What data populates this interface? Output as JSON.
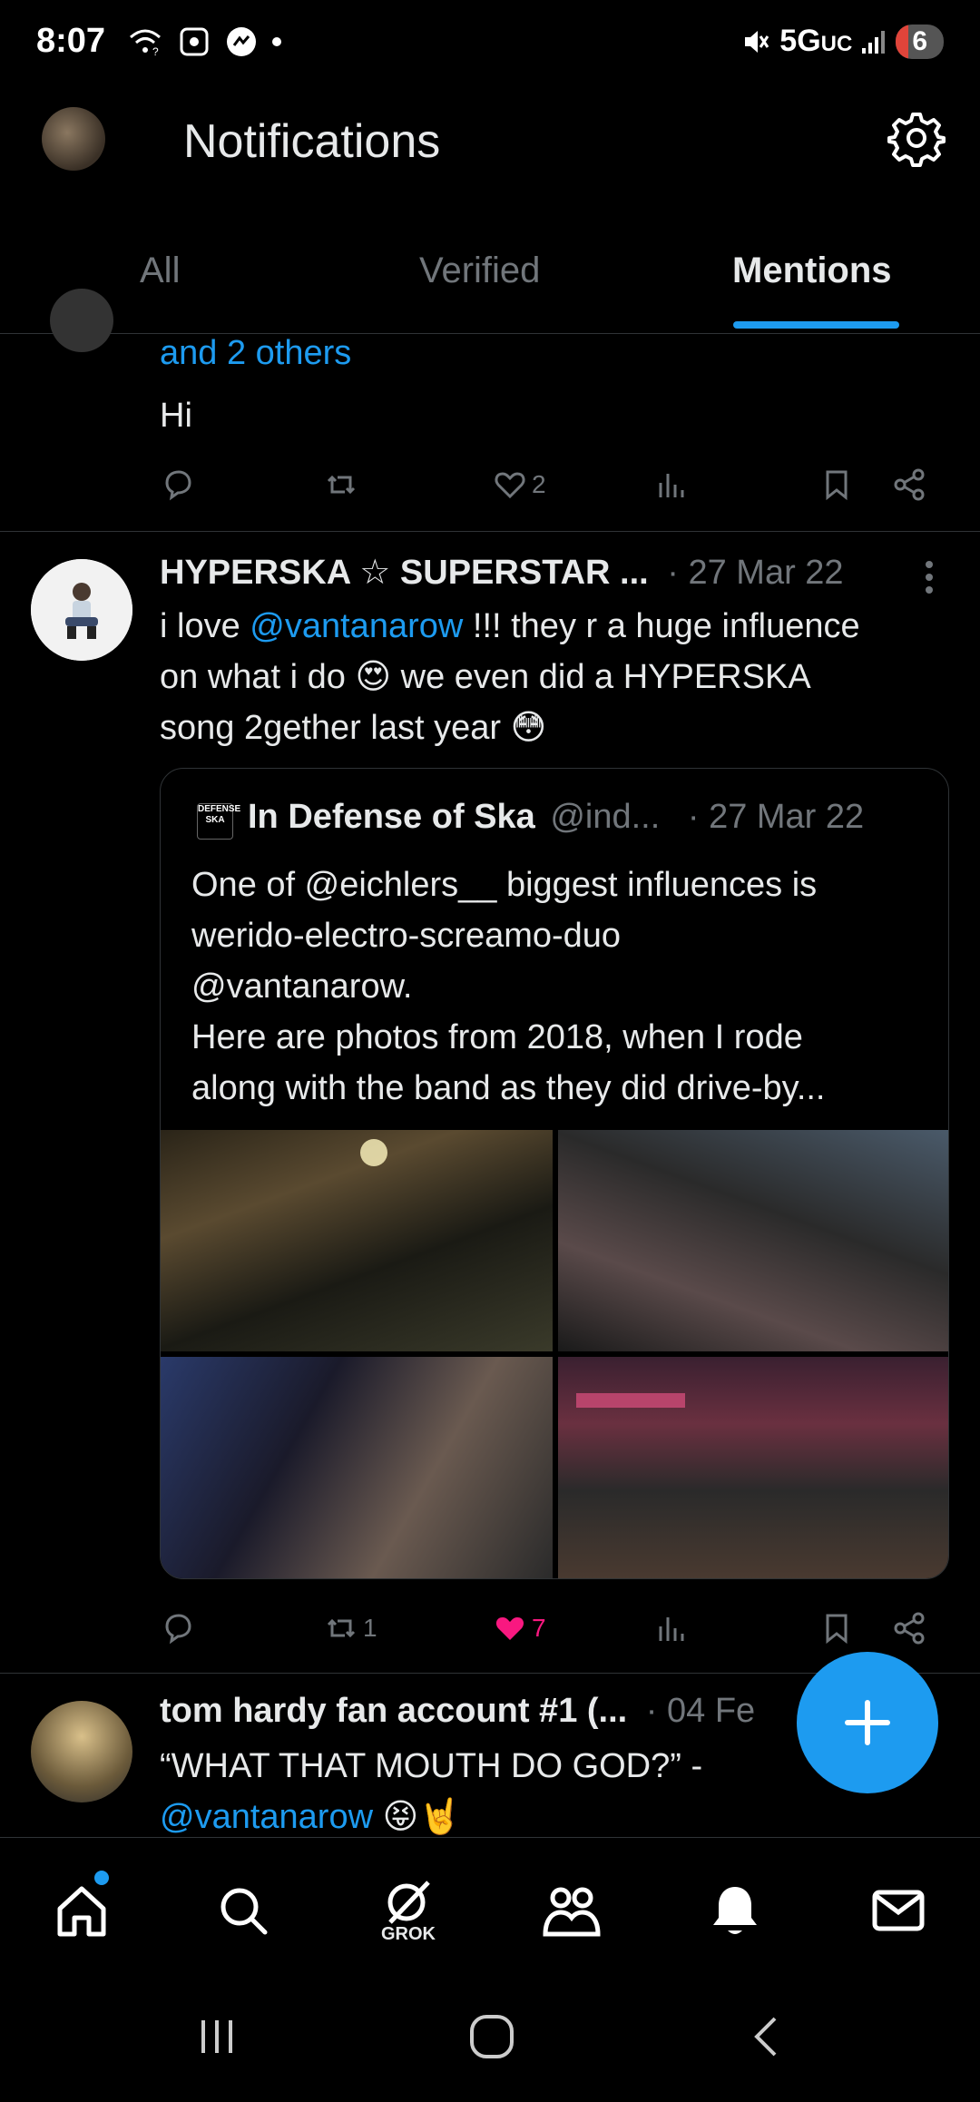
{
  "status_bar": {
    "time": "8:07",
    "network": "5G",
    "network_sub": "UC",
    "battery": "6"
  },
  "header": {
    "title": "Notifications"
  },
  "tabs": [
    {
      "label": "All",
      "active": false
    },
    {
      "label": "Verified",
      "active": false
    },
    {
      "label": "Mentions",
      "active": true
    }
  ],
  "post1": {
    "continuation_link": "and 2 others",
    "text": "Hi",
    "likes": "2"
  },
  "post2": {
    "author": "HYPERSKA ☆ SUPERSTAR ...",
    "date": "· 27 Mar 22",
    "text_parts": {
      "line1_a": "i love ",
      "mention": "@vantanarow",
      "line1_b": " !!! they r a huge influence",
      "line2": "on what i do 😍 we even did a HYPERSKA",
      "line3": "song 2gether last year 😳"
    },
    "quote": {
      "author": "In Defense of Ska",
      "handle": "@ind...",
      "date": "· 27 Mar 22",
      "logo_text": "DEFENSE SKA",
      "lines": [
        "One of @eichlers__ biggest influences is",
        "werido-electro-screamo-duo",
        "@vantanarow.",
        "Here are photos from 2018, when I rode",
        "along with the band as they did drive-by..."
      ]
    },
    "reposts": "1",
    "likes": "7"
  },
  "post3": {
    "author": "tom hardy fan account #1 (...",
    "date": "· 04 Fe",
    "line1": "“WHAT THAT MOUTH DO GOD?” -",
    "mention": "@vantanarow",
    "emoji": "😝🤘"
  },
  "bottom_nav": {
    "grok_label": "GROK"
  },
  "colors": {
    "accent": "#1d9bf0",
    "like": "#f91880",
    "muted": "#71767b",
    "text": "#e7e9ea"
  }
}
